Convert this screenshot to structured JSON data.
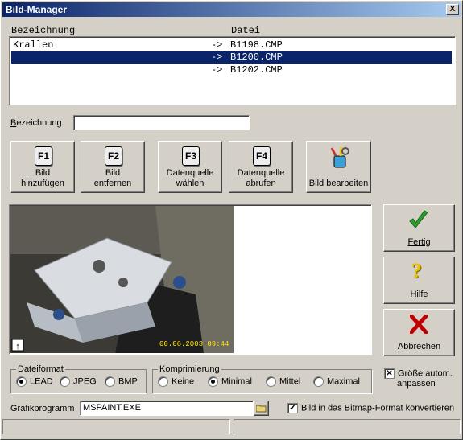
{
  "window": {
    "title": "Bild-Manager",
    "close": "X"
  },
  "list": {
    "headers": {
      "name": "Bezeichnung",
      "file": "Datei"
    },
    "rows": [
      {
        "name": "Krallen",
        "arrow": "->",
        "file": "B1198.CMP",
        "selected": false
      },
      {
        "name": "",
        "arrow": "->",
        "file": "B1200.CMP",
        "selected": true
      },
      {
        "name": "",
        "arrow": "->",
        "file": "B1202.CMP",
        "selected": false
      }
    ]
  },
  "bezeichnung": {
    "label": "Bezeichnung",
    "value": ""
  },
  "toolbar": {
    "add": {
      "key": "F1",
      "line1": "Bild",
      "line2": "hinzufügen"
    },
    "remove": {
      "key": "F2",
      "line1": "Bild",
      "line2": "entfernen"
    },
    "source_select": {
      "key": "F3",
      "line1": "Datenquelle",
      "line2": "wählen"
    },
    "source_fetch": {
      "key": "F4",
      "line1": "Datenquelle",
      "line2": "abrufen"
    },
    "edit": {
      "label": "Bild bearbeiten"
    }
  },
  "preview": {
    "timestamp": "00.06.2003  09:44"
  },
  "actions": {
    "done": "Fertig",
    "help": "Hilfe",
    "cancel": "Abbrechen"
  },
  "format": {
    "title": "Dateiformat",
    "options": [
      "LEAD",
      "JPEG",
      "BMP"
    ],
    "selected": "LEAD"
  },
  "compression": {
    "title": "Komprimierung",
    "options": [
      "Keine",
      "Minimal",
      "Mittel",
      "Maximal"
    ],
    "selected": "Minimal"
  },
  "autosize": {
    "line1": "Größe autom.",
    "line2": "anpassen",
    "checked": true
  },
  "program": {
    "label": "Grafikprogramm",
    "value": "MSPAINT.EXE"
  },
  "bitmap": {
    "label": "Bild in das Bitmap-Format konvertieren",
    "checked": true
  },
  "colors": {
    "titlebar": "#0a246a",
    "selection": "#0a246a",
    "check": "#2e9b2e",
    "cancel": "#c00000",
    "help": "#e8c400"
  }
}
